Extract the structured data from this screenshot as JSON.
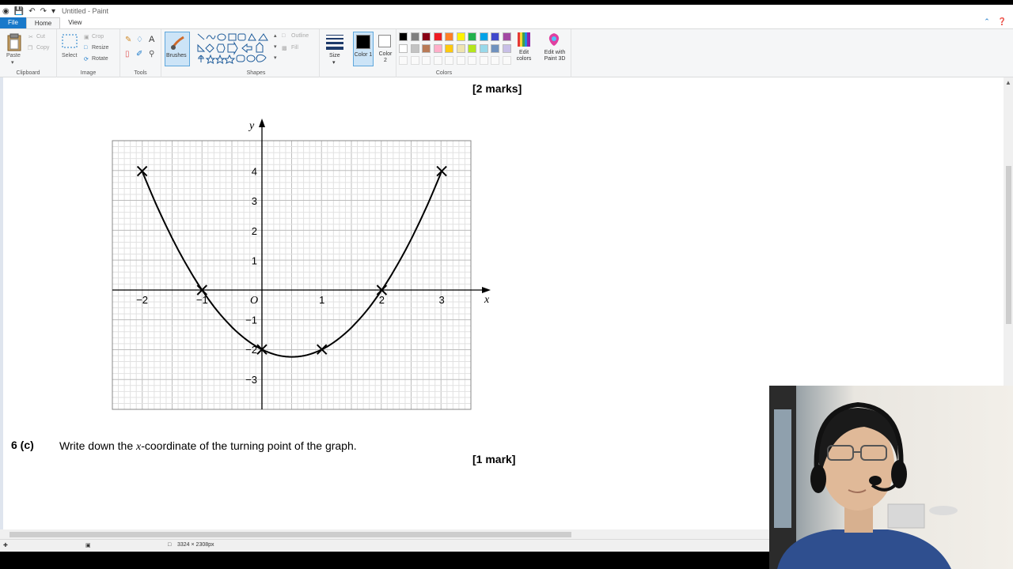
{
  "window": {
    "title": "Untitled - Paint"
  },
  "menu": {
    "tabs": [
      "File",
      "Home",
      "View"
    ]
  },
  "ribbon": {
    "clipboard": {
      "label": "Clipboard",
      "paste": "Paste",
      "cut": "Cut",
      "copy": "Copy"
    },
    "image": {
      "label": "Image",
      "select": "Select",
      "crop": "Crop",
      "resize": "Resize",
      "rotate": "Rotate"
    },
    "tools": {
      "label": "Tools"
    },
    "brushes": {
      "label": "Brushes"
    },
    "shapes": {
      "label": "Shapes",
      "outline": "Outline",
      "fill": "Fill"
    },
    "size": {
      "label": "Size"
    },
    "color1": {
      "label": "Color 1"
    },
    "color2": {
      "label": "Color 2"
    },
    "colors": {
      "label": "Colors",
      "edit": "Edit colors",
      "row1": [
        "#000000",
        "#7f7f7f",
        "#880015",
        "#ed1c24",
        "#ff7f27",
        "#fff200",
        "#22b14c",
        "#00a2e8",
        "#3f48cc",
        "#a349a4"
      ],
      "row2": [
        "#ffffff",
        "#c3c3c3",
        "#b97a57",
        "#ffaec9",
        "#ffc90e",
        "#efe4b0",
        "#b5e61d",
        "#99d9ea",
        "#7092be",
        "#c8bfe7"
      ]
    },
    "paint3d": {
      "label": "Edit with Paint 3D"
    }
  },
  "document": {
    "marks_top": "[2 marks]",
    "question_num": "6  (c)",
    "question_pre": "Write down the ",
    "question_var": "x",
    "question_post": "-coordinate of the turning point of the graph.",
    "marks_bottom": "[1 mark]"
  },
  "graph": {
    "x_axis_label": "x",
    "y_axis_label": "y",
    "origin_label": "O",
    "x_ticks": [
      "−2",
      "−1",
      "1",
      "2",
      "3"
    ],
    "y_ticks": [
      "4",
      "3",
      "2",
      "1",
      "−1",
      "−2",
      "−3"
    ],
    "curve": {
      "points": [
        [
          -2,
          4
        ],
        [
          -1,
          0
        ],
        [
          0,
          -2
        ],
        [
          1,
          -2
        ],
        [
          2,
          0
        ],
        [
          3,
          4
        ]
      ]
    }
  },
  "statusbar": {
    "dimensions": "3324 × 2308px"
  }
}
